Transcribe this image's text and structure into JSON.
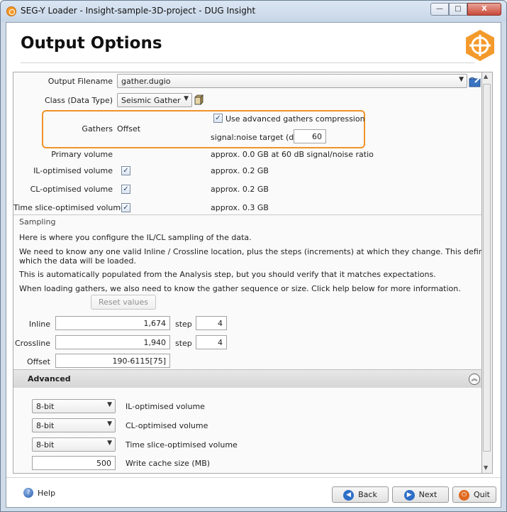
{
  "window": {
    "title": "SEG-Y Loader - Insight-sample-3D-project - DUG Insight",
    "minimize_label": "—",
    "maximize_label": "□",
    "close_label": "X"
  },
  "header": {
    "title": "Output Options"
  },
  "output": {
    "filename_label": "Output Filename",
    "filename_value": "gather.dugio",
    "class_label": "Class (Data Type)",
    "class_value": "Seismic Gather",
    "gathers_label": "Gathers",
    "gathers_value": "Offset",
    "advanced_compression_label": "Use advanced gathers compression",
    "advanced_compression_checked": true,
    "snr_label": "signal:noise target (dB)",
    "snr_value": "60",
    "primary_label": "Primary volume",
    "primary_info": "approx. 0.0 GB at 60 dB signal/noise ratio",
    "il_label": "IL-optimised volume",
    "il_info": "approx. 0.2 GB",
    "cl_label": "CL-optimised volume",
    "cl_info": "approx. 0.2 GB",
    "ts_label": "Time slice-optimised volume",
    "ts_info": "approx. 0.3 GB"
  },
  "sampling": {
    "section_label": "Sampling",
    "text1": "Here is where you configure the IL/CL sampling of the data.",
    "text2a": "We need to know any one valid Inline / Crossline location, plus the steps (increments) at which they change. This defines the grid on",
    "text2b": "which the data will be loaded.",
    "text3": "This is automatically populated from the Analysis step, but you should verify that it matches expectations.",
    "text4": "When loading gathers, we also need to know the gather sequence or size.  Click help below for more information.",
    "reset_label": "Reset values",
    "inline_label": "Inline",
    "inline_value": "1,674",
    "inline_step_label": "step",
    "inline_step": "4",
    "crossline_label": "Crossline",
    "crossline_value": "1,940",
    "crossline_step_label": "step",
    "crossline_step": "4",
    "offset_label": "Offset",
    "offset_value": "190-6115[75]"
  },
  "advanced": {
    "title": "Advanced",
    "il_bits": "8-bit",
    "il_label": "IL-optimised volume",
    "cl_bits": "8-bit",
    "cl_label": "CL-optimised volume",
    "ts_bits": "8-bit",
    "ts_label": "Time slice-optimised volume",
    "cache_value": "500",
    "cache_label": "Write cache size (MB)"
  },
  "footer": {
    "help_label": "Help",
    "back_label": "Back",
    "next_label": "Next",
    "quit_label": "Quit"
  },
  "colors": {
    "highlight_border": "#f0932a",
    "logo_orange": "#f39a2c",
    "button_blue": "#2e6fc7",
    "quit_orange": "#e0681f"
  }
}
